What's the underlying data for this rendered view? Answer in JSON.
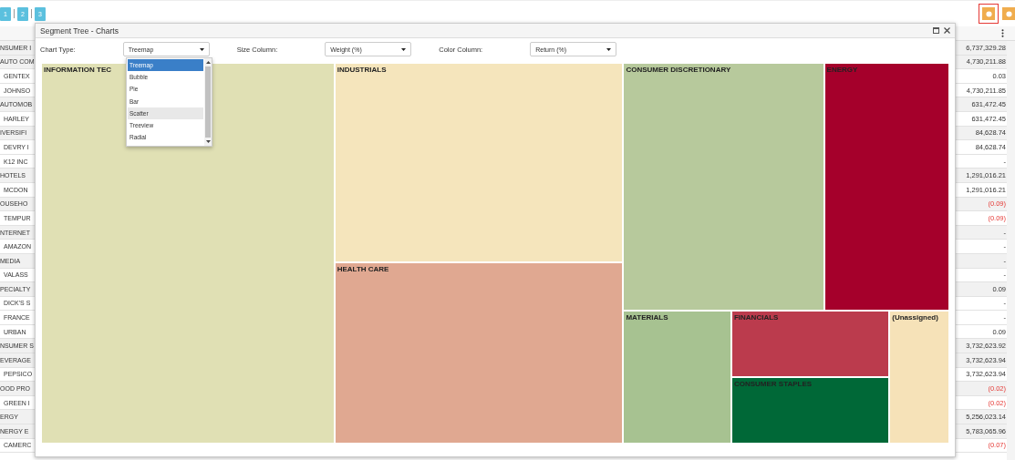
{
  "pager": [
    {
      "label": "1"
    },
    {
      "label": "2"
    },
    {
      "label": "3"
    }
  ],
  "toolbar_buttons": [
    {
      "outlined": true
    },
    {
      "outlined": false
    }
  ],
  "grid": {
    "rows": [
      {
        "label": "NSUMER I",
        "value": "6,737,329.28",
        "negative": false,
        "children": [
          {
            "label": "AUTO COM",
            "value": "4,730,211.88",
            "negative": false,
            "children": [
              {
                "label": "GENTEX",
                "value": "0.03",
                "negative": false
              },
              {
                "label": "JOHNSO",
                "value": "4,730,211.85",
                "negative": false
              }
            ]
          },
          {
            "label": "AUTOMOB",
            "value": "631,472.45",
            "negative": false,
            "children": [
              {
                "label": "HARLEY",
                "value": "631,472.45",
                "negative": false
              }
            ]
          },
          {
            "label": "IVERSIFI",
            "value": "84,628.74",
            "negative": false,
            "children": [
              {
                "label": "DEVRY I",
                "value": "84,628.74",
                "negative": false
              },
              {
                "label": "K12 INC",
                "value": "-",
                "negative": false
              }
            ]
          },
          {
            "label": "HOTELS",
            "value": "1,291,016.21",
            "negative": false,
            "children": [
              {
                "label": "MCDON",
                "value": "1,291,016.21",
                "negative": false
              }
            ]
          },
          {
            "label": "OUSEHO",
            "value": "(0.09)",
            "negative": true,
            "children": [
              {
                "label": "TEMPUR",
                "value": "(0.09)",
                "negative": true
              }
            ]
          },
          {
            "label": "NTERNET",
            "value": "-",
            "negative": false,
            "children": [
              {
                "label": "AMAZON",
                "value": "-",
                "negative": false
              }
            ]
          },
          {
            "label": "MEDIA",
            "value": "-",
            "negative": false,
            "children": [
              {
                "label": "VALASS",
                "value": "-",
                "negative": false
              }
            ]
          },
          {
            "label": "PECIALTY",
            "value": "0.09",
            "negative": false,
            "children": [
              {
                "label": "DICK'S S",
                "value": "-",
                "negative": false
              },
              {
                "label": "FRANCE",
                "value": "-",
                "negative": false
              },
              {
                "label": "URBAN",
                "value": "0.09",
                "negative": false
              }
            ]
          }
        ]
      },
      {
        "label": "NSUMER S",
        "value": "3,732,623.92",
        "negative": false,
        "children": [
          {
            "label": "EVERAGE",
            "value": "3,732,623.94",
            "negative": false,
            "children": [
              {
                "label": "PEPSICO",
                "value": "3,732,623.94",
                "negative": false
              }
            ]
          },
          {
            "label": "OOD PRO",
            "value": "(0.02)",
            "negative": true,
            "children": [
              {
                "label": "GREEN I",
                "value": "(0.02)",
                "negative": true
              }
            ]
          }
        ]
      },
      {
        "label": "ERGY",
        "value": "5,256,023.14",
        "negative": false,
        "children": [
          {
            "label": "NERGY E",
            "value": "5,783,065.96",
            "negative": false,
            "children": [
              {
                "label": "CAMERC",
                "value": "(0.07)",
                "negative": true
              }
            ]
          }
        ]
      }
    ]
  },
  "dialog": {
    "title": "Segment Tree - Charts",
    "controls": [
      {
        "label": "Chart Type:",
        "value": "Treemap"
      },
      {
        "label": "Size Column:",
        "value": "Weight (%)"
      },
      {
        "label": "Color Column:",
        "value": "Return (%)"
      }
    ],
    "dropdown": {
      "options": [
        {
          "label": "Treemap",
          "selected": true,
          "hovered": false
        },
        {
          "label": "Bubble",
          "selected": false,
          "hovered": false
        },
        {
          "label": "Pie",
          "selected": false,
          "hovered": false
        },
        {
          "label": "Bar",
          "selected": false,
          "hovered": false
        },
        {
          "label": "Scatter",
          "selected": false,
          "hovered": true
        },
        {
          "label": "Treeview",
          "selected": false,
          "hovered": false
        },
        {
          "label": "Radial",
          "selected": false,
          "hovered": false
        }
      ]
    },
    "treemap": [
      {
        "label": "INFORMATION TEC",
        "color": "#e0e0b4"
      },
      {
        "label": "INDUSTRIALS",
        "color": "#f5e5bc"
      },
      {
        "label": "HEALTH CARE",
        "color": "#e0a891"
      },
      {
        "label": "CONSUMER DISCRETIONARY",
        "color": "#b7c99c"
      },
      {
        "label": "ENERGY",
        "color": "#a5002b"
      },
      {
        "label": "MATERIALS",
        "color": "#a7c291"
      },
      {
        "label": "FINANCIALS",
        "color": "#bb3b4d"
      },
      {
        "label": "CONSUMER STAPLES",
        "color": "#006837"
      },
      {
        "label": "(Unassigned)",
        "color": "#f6e2b8"
      }
    ]
  }
}
